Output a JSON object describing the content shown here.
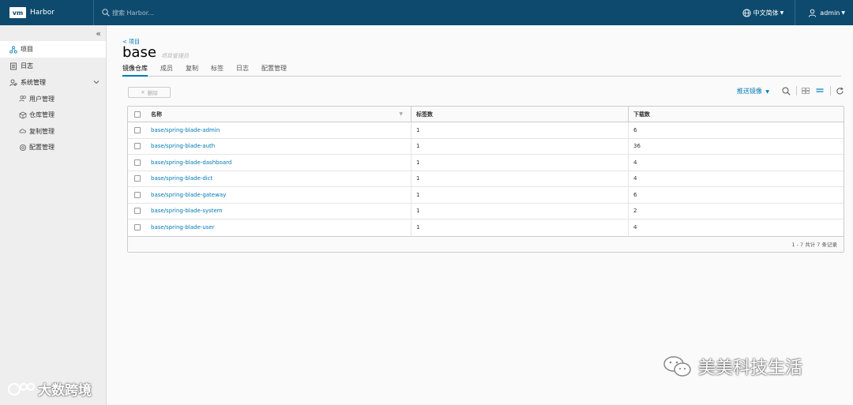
{
  "header": {
    "logo": "vm",
    "app_name": "Harbor",
    "search_placeholder": "搜索 Harbor...",
    "language": "中文简体",
    "user": "admin"
  },
  "sidebar": {
    "collapse_glyph": "«",
    "items": [
      {
        "label": "项目",
        "icon": "projects-icon",
        "active": true
      },
      {
        "label": "日志",
        "icon": "logs-icon"
      },
      {
        "label": "系统管理",
        "icon": "admin-icon"
      }
    ],
    "sub_items": [
      {
        "label": "用户管理",
        "icon": "users-icon"
      },
      {
        "label": "仓库管理",
        "icon": "registry-icon"
      },
      {
        "label": "复制管理",
        "icon": "replication-icon"
      },
      {
        "label": "配置管理",
        "icon": "config-icon"
      }
    ]
  },
  "project": {
    "back_link": "< 项目",
    "name": "base",
    "role": "项目管理员",
    "tabs": [
      "镜像仓库",
      "成员",
      "复制",
      "标签",
      "日志",
      "配置管理"
    ],
    "active_tab": 0
  },
  "toolbar": {
    "delete_label": "删除",
    "push_label": "推送镜像"
  },
  "table": {
    "columns": [
      "名称",
      "标签数",
      "下载数"
    ],
    "rows": [
      {
        "name": "base/spring-blade-admin",
        "tags": "1",
        "downloads": "6"
      },
      {
        "name": "base/spring-blade-auth",
        "tags": "1",
        "downloads": "36"
      },
      {
        "name": "base/spring-blade-dashboard",
        "tags": "1",
        "downloads": "4"
      },
      {
        "name": "base/spring-blade-dict",
        "tags": "1",
        "downloads": "4"
      },
      {
        "name": "base/spring-blade-gateway",
        "tags": "1",
        "downloads": "6"
      },
      {
        "name": "base/spring-blade-system",
        "tags": "1",
        "downloads": "2"
      },
      {
        "name": "base/spring-blade-user",
        "tags": "1",
        "downloads": "4"
      }
    ],
    "footer": "1 - 7 共计 7 条记录"
  },
  "watermarks": {
    "left": "大数跨境",
    "right": "美美科技生活"
  },
  "colors": {
    "header_bg": "#0e4a6d",
    "link": "#0079b8",
    "sidebar_bg": "#eeeeee"
  }
}
